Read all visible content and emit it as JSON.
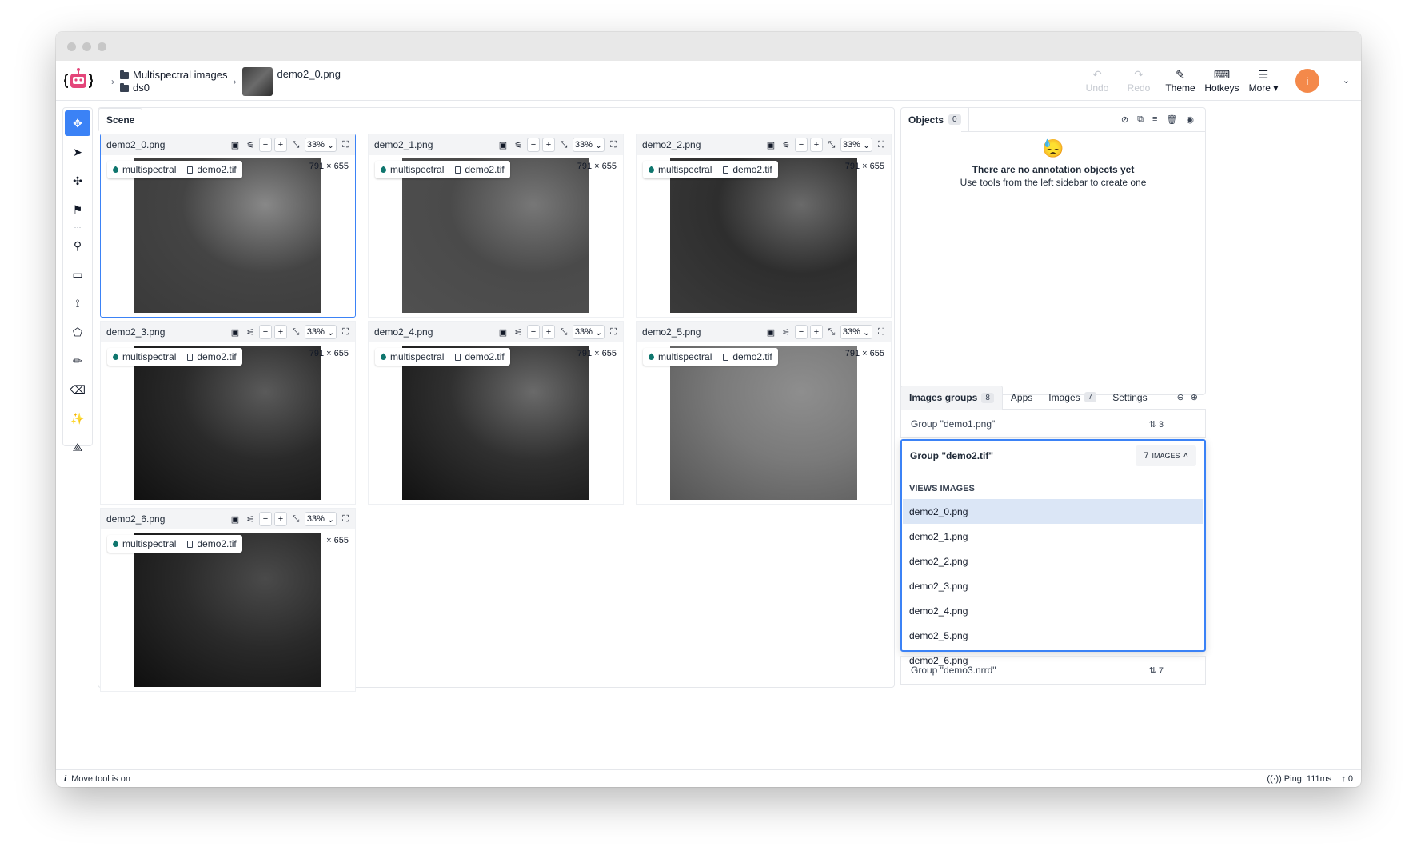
{
  "header": {
    "breadcrumb_project": "Multispectral images",
    "breadcrumb_dataset": "ds0",
    "breadcrumb_image": "demo2_0.png",
    "undo_label": "Undo",
    "redo_label": "Redo",
    "theme_label": "Theme",
    "hotkeys_label": "Hotkeys",
    "more_label": "More",
    "avatar_initial": "i"
  },
  "scene": {
    "tab_label": "Scene",
    "cards": [
      {
        "name": "demo2_0.png",
        "zoom": "33%",
        "dims": "791 × 655",
        "tag": "multispectral",
        "file": "demo2.tif"
      },
      {
        "name": "demo2_1.png",
        "zoom": "33%",
        "dims": "791 × 655",
        "tag": "multispectral",
        "file": "demo2.tif"
      },
      {
        "name": "demo2_2.png",
        "zoom": "33%",
        "dims": "791 × 655",
        "tag": "multispectral",
        "file": "demo2.tif"
      },
      {
        "name": "demo2_3.png",
        "zoom": "33%",
        "dims": "791 × 655",
        "tag": "multispectral",
        "file": "demo2.tif"
      },
      {
        "name": "demo2_4.png",
        "zoom": "33%",
        "dims": "791 × 655",
        "tag": "multispectral",
        "file": "demo2.tif"
      },
      {
        "name": "demo2_5.png",
        "zoom": "33%",
        "dims": "791 × 655",
        "tag": "multispectral",
        "file": "demo2.tif"
      },
      {
        "name": "demo2_6.png",
        "zoom": "33%",
        "dims": "× 655",
        "tag": "multispectral",
        "file": "demo2.tif"
      }
    ]
  },
  "objects": {
    "tab_label": "Objects",
    "count": "0",
    "empty_title": "There are no annotation objects yet",
    "empty_subtitle": "Use tools from the left sidebar to create one"
  },
  "groups": {
    "tabs": [
      {
        "label": "Images groups",
        "badge": "8"
      },
      {
        "label": "Apps",
        "badge": ""
      },
      {
        "label": "Images",
        "badge": "7"
      },
      {
        "label": "Settings",
        "badge": ""
      }
    ],
    "row1": {
      "label": "Group \"demo1.png\"",
      "count": "3"
    },
    "expanded": {
      "label": "Group \"demo2.tif\"",
      "button_count": "7",
      "button_text": "images",
      "views_label": "VIEWS IMAGES"
    },
    "views": [
      "demo2_0.png",
      "demo2_1.png",
      "demo2_2.png",
      "demo2_3.png",
      "demo2_4.png",
      "demo2_5.png",
      "demo2_6.png"
    ],
    "row3": {
      "label": "Group \"demo3.nrrd\"",
      "count": "7"
    }
  },
  "status": {
    "left": "Move tool is on",
    "ping": "Ping: 111ms",
    "uploads": "0"
  },
  "icons": {
    "toolbar": [
      "move-icon",
      "pointer-icon",
      "drag-icon",
      "flag-icon",
      "keypoint-icon",
      "rectangle-icon",
      "polyline-icon",
      "polygon-icon",
      "brush-icon",
      "eraser-icon",
      "magic-wand-icon",
      "graph-icon"
    ]
  },
  "colors": {
    "accent": "#3b82f6",
    "avatar": "#f4894a",
    "tag": "#0f766e"
  }
}
